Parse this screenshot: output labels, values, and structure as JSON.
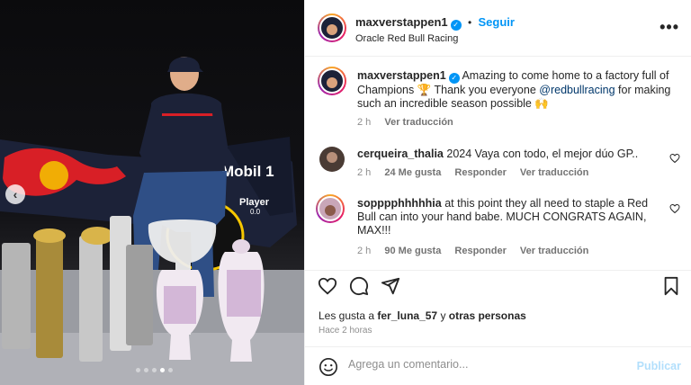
{
  "post_image": {
    "car_sponsor_text": "Mobil 1",
    "player_text": "Player",
    "player_number": "0.0"
  },
  "header": {
    "username": "maxverstappen1",
    "separator": "•",
    "follow_label": "Seguir",
    "location": "Oracle Red Bull Racing",
    "more_icon": "more-horizontal-icon"
  },
  "caption": {
    "username": "maxverstappen1",
    "text_before": "Amazing to come home to a factory full of Champions 🏆 Thank you everyone",
    "mention": "@redbullracing",
    "text_after": "for making such an incredible season possible 🙌",
    "time": "2 h",
    "translate": "Ver traducción"
  },
  "comments": [
    {
      "username": "cerqueira_thalia",
      "text": "2024 Vaya con todo, el mejor dúo GP..",
      "time": "2 h",
      "likes": "24 Me gusta",
      "reply": "Responder",
      "translate": "Ver traducción"
    },
    {
      "username": "sopppphhhhhia",
      "text": "at this point they all need to staple a Red Bull can into your hand babe. MUCH CONGRATS AGAIN, MAX!!!",
      "time": "2 h",
      "likes": "90 Me gusta",
      "reply": "Responder",
      "translate": "Ver traducción"
    }
  ],
  "actions": {
    "likes_prefix": "Les gusta a",
    "liked_by": "fer_luna_57",
    "likes_joiner": "y",
    "others": "otras personas",
    "time_ago": "Hace 2 horas"
  },
  "add_comment": {
    "placeholder": "Agrega un comentario...",
    "publish_label": "Publicar"
  },
  "carousel": {
    "dot_count": 5,
    "active_index": 3
  },
  "colors": {
    "accent": "#0095f6",
    "red_bull_navy": "#1c2238",
    "red_bull_red": "#d81f26",
    "red_bull_yellow": "#f6c700"
  }
}
